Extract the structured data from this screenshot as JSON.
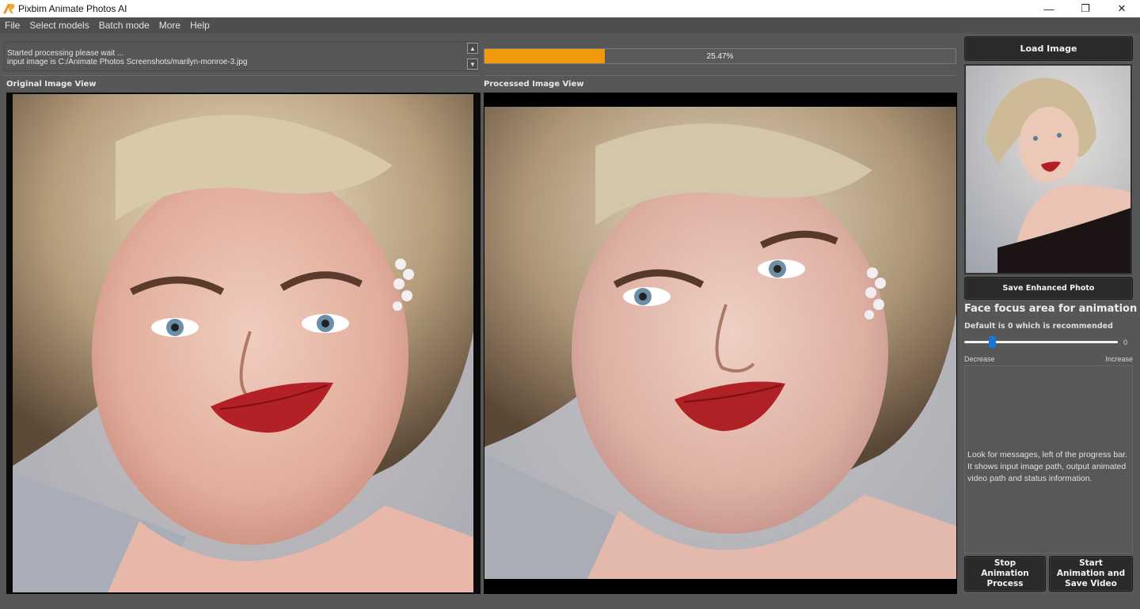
{
  "window": {
    "title": "Pixbim Animate Photos AI",
    "controls": {
      "minimize": "—",
      "maximize": "❐",
      "close": "✕"
    },
    "logo_color": "#f08a1c"
  },
  "menu": [
    "File",
    "Select models",
    "Batch mode",
    "More",
    "Help"
  ],
  "log": {
    "lines": [
      "Started processing please wait ...",
      "input image is C:/Animate  Photos Screenshots/marilyn-monroe-3.jpg",
      "..."
    ],
    "scroll_up": "▲",
    "scroll_down": "▼"
  },
  "progress": {
    "value_percent": 25.47,
    "label": "25.47%",
    "fill_color": "#f39a0c"
  },
  "views": {
    "original_label": "Original Image View",
    "processed_label": "Processed Image View"
  },
  "sidebar": {
    "load_button": "Load Image",
    "save_button": "Save Enhanced Photo",
    "focus_title": "Face focus area for animation",
    "focus_subtitle": "Default is 0 which is recommended",
    "slider": {
      "value": "0",
      "min_label": "Decrease",
      "max_label": "Increase",
      "position_fraction": 0.18,
      "thumb_color": "#1e73d6"
    },
    "info_text": "Look for messages, left of the progress bar. It shows input image path, output animated video path and status information.",
    "stop_button": "Stop Animation Process",
    "start_button": "Start Animation and Save Video"
  }
}
